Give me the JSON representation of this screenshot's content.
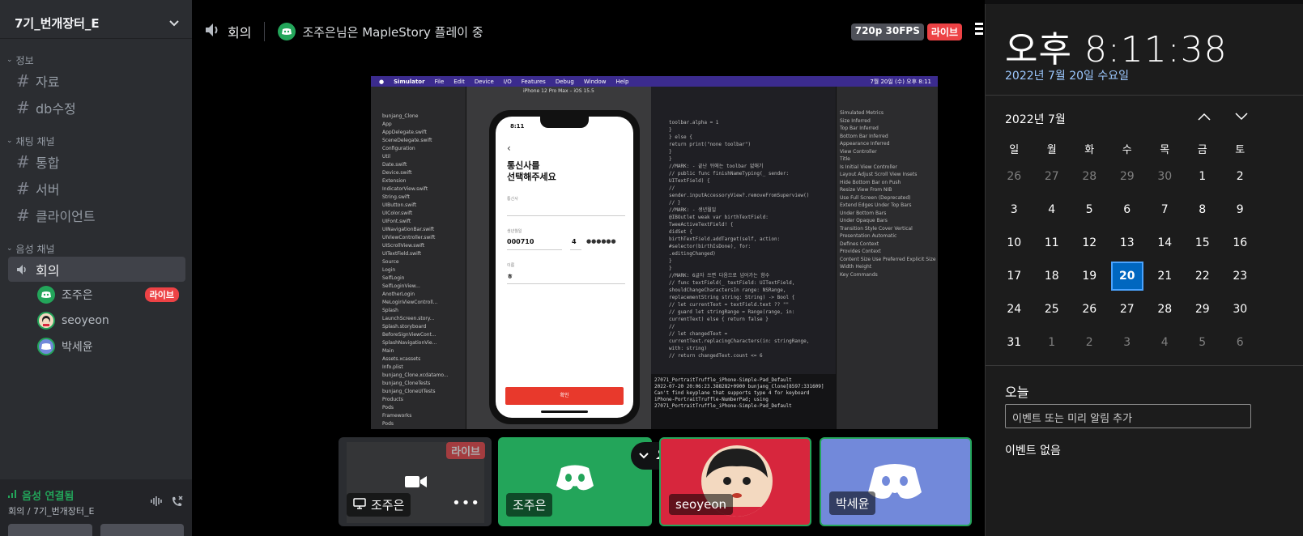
{
  "sidebar": {
    "server_name": "7기_번개장터_E",
    "categories": [
      {
        "label": "정보",
        "channels": [
          "자료",
          "db수정"
        ]
      },
      {
        "label": "채팅 채널",
        "channels": [
          "통합",
          "서버",
          "클라이언트"
        ]
      },
      {
        "label": "음성 채널"
      }
    ],
    "voice_channel": "회의",
    "voice_users": [
      {
        "name": "조주은",
        "badge": "라이브"
      },
      {
        "name": "seoyeon"
      },
      {
        "name": "박세윤"
      }
    ],
    "voice_panel": {
      "status": "음성 연결됨",
      "location": "회의 / 7기_번개장터_E"
    }
  },
  "topbar": {
    "channel": "회의",
    "activity": "조주은님은 MapleStory 플레이 중",
    "quality": "720p 30FPS",
    "live": "라이브"
  },
  "stream": {
    "menu": [
      "Simulator",
      "File",
      "Edit",
      "Device",
      "I/O",
      "Features",
      "Debug",
      "Window",
      "Help"
    ],
    "menu_right": "7월 20일 (수) 오후 8:11",
    "simulator_title": "iPhone 12 Pro Max – iOS 15.5",
    "nav_items": [
      "bunjang_Clone",
      "App",
      "AppDelegate.swift",
      "SceneDelegate.swift",
      "Configuration",
      "Util",
      "Date.swift",
      "Device.swift",
      "Extension",
      "IndicatorView.swift",
      "String.swift",
      "UIButton.swift",
      "UIColor.swift",
      "UIFont.swift",
      "UINavigationBar.swift",
      "UIViewController.swift",
      "UIScrollView.swift",
      "UITextField.swift",
      "Source",
      "Login",
      "SelfLogin",
      "SelfLoginView...",
      "AnotherLogin",
      "MeLoginViewControll...",
      "Splash",
      "LaunchScreen.story...",
      "Splash.storyboard",
      "BeforeSignViewCont...",
      "SplashNavigationVie...",
      "Main",
      "Assets.xcassets",
      "Info.plist",
      "bunjang_Clone.xcdatamo...",
      "bunjang_CloneTests",
      "bunjang_CloneUITests",
      "Products",
      "Pods",
      "Frameworks",
      "Pods"
    ],
    "code_lines": [
      "toolbar.alpha = 1",
      "}",
      "} else {",
      "return print(\"none toolbar\")",
      "}",
      "}",
      "",
      "//MARK: - 끝난 뒤에는 toolbar 없애기",
      "//  public func finishNameTyping(_ sender:",
      "UITextField) {",
      "//",
      "sender.inputAccessoryView?.removeFromSuperview()",
      "//  }",
      "",
      "//MARK: - 생년월일",
      "@IBOutlet weak var birthTextField:",
      "TweeActiveTextField! {",
      "didSet {",
      "birthTextField.addTarget(self, action:",
      "#selector(birthIsDone), for:",
      ".editingChanged)",
      "}",
      "}",
      "",
      "//MARK: 6글자 쓰면 다음으로 넘어가는 함수",
      "//  func textField(_ textField: UITextField,",
      "shouldChangeCharactersIn range: NSRange,",
      "replacementString string: String) -> Bool {",
      "//    let currentText = textField.text ?? \"\"",
      "//    guard let stringRange = Range(range, in:",
      "currentText) else { return false }",
      "//",
      "//    let changedText =",
      "currentText.replacingCharacters(in: stringRange,",
      "with: string)",
      "//    return changedText.count <= 6"
    ],
    "console_lines": [
      "27071_PortraitTruffle_iPhone-Simple-Pad_Default",
      "2022-07-20 20:06:23.388282+0900 bunjang_Clone[8597:331609]",
      "  Can't find keyplane that supports type 4 for keyboard",
      "  iPhone-PortraitTruffle-NumberPad; using",
      "  27071_PortraitTruffle_iPhone-Simple-Pad_Default"
    ],
    "inspector_lines": [
      "Simulated Metrics",
      "Size  Inferred",
      "Top Bar  Inferred",
      "Bottom Bar  Inferred",
      "Appearance  Inferred",
      "",
      "View Controller",
      "Title",
      "Is Initial View Controller",
      "Layout  Adjust Scroll View Insets",
      "Hide Bottom Bar on Push",
      "Resize View From NIB",
      "Use Full Screen (Deprecated)",
      "Extend Edges  Under Top Bars",
      "Under Bottom Bars",
      "Under Opaque Bars",
      "Transition Style  Cover Vertical",
      "Presentation  Automatic",
      "Defines Context",
      "Provides Context",
      "Content Size  Use Preferred Explicit Size",
      "Width   Height",
      "",
      "Key Commands"
    ],
    "phone": {
      "time": "8:11",
      "title_line1": "통신사를",
      "title_line2": "선택해주세요",
      "field1_label": "통신사",
      "field2_label": "생년월일",
      "birth_value": "000710",
      "gender_value": "4",
      "masked": "●●●●●●",
      "field3_label": "이름",
      "name_value": "ㅎ",
      "button": "확인"
    }
  },
  "tiles": [
    {
      "name": "조주은",
      "badge": "라이브",
      "color": "#2b2d31"
    },
    {
      "name": "조주은",
      "color": "#23a55a"
    },
    {
      "name": "seoyeon",
      "color": "#d7263d"
    },
    {
      "name": "박세윤",
      "color": "#7289da"
    }
  ],
  "clock": {
    "time": "오후 8:11:38",
    "date": "2022년 7월 20일 수요일",
    "month": "2022년 7월",
    "weekdays": [
      "일",
      "월",
      "화",
      "수",
      "목",
      "금",
      "토"
    ],
    "weeks": [
      [
        "26",
        "27",
        "28",
        "29",
        "30",
        "1",
        "2"
      ],
      [
        "3",
        "4",
        "5",
        "6",
        "7",
        "8",
        "9"
      ],
      [
        "10",
        "11",
        "12",
        "13",
        "14",
        "15",
        "16"
      ],
      [
        "17",
        "18",
        "19",
        "20",
        "21",
        "22",
        "23"
      ],
      [
        "24",
        "25",
        "26",
        "27",
        "28",
        "29",
        "30"
      ],
      [
        "31",
        "1",
        "2",
        "3",
        "4",
        "5",
        "6"
      ]
    ],
    "today_label": "오늘",
    "event_placeholder": "이벤트 또는 미리 알림 추가",
    "no_events": "이벤트 없음"
  }
}
